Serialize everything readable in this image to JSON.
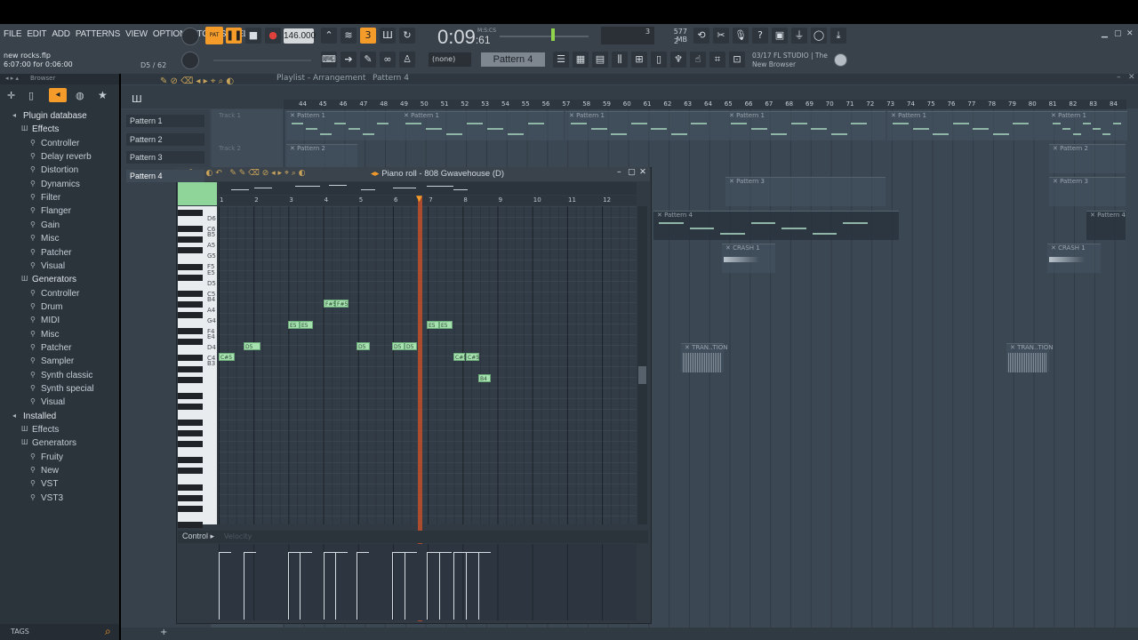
{
  "menu": [
    "FILE",
    "EDIT",
    "ADD",
    "PATTERNS",
    "VIEW",
    "OPTIONS",
    "TOOLS",
    "HELP"
  ],
  "transport": {
    "pat_label": "PAT",
    "tempo": "146.000",
    "time_main": "0:09",
    "time_sub": "61",
    "time_unit": "M:S:CS",
    "cpu_value": "3",
    "memory": "577 MB",
    "poly": "2"
  },
  "project": {
    "file": "new rocks.flp",
    "time": "6:07:00 for 0:06:00",
    "hint_note": "D5 / 62"
  },
  "pattern_selector": {
    "none_label": "(none)",
    "current": "Pattern 4"
  },
  "news": {
    "line1": "03/17  FL STUDIO | The",
    "line2": "New Browser"
  },
  "browser": {
    "title": "Browser",
    "tree": [
      {
        "label": "Plugin database",
        "level": 0,
        "bold": true
      },
      {
        "label": "Effects",
        "level": 1,
        "bold": true
      },
      {
        "label": "Controller",
        "level": 2
      },
      {
        "label": "Delay reverb",
        "level": 2
      },
      {
        "label": "Distortion",
        "level": 2
      },
      {
        "label": "Dynamics",
        "level": 2
      },
      {
        "label": "Filter",
        "level": 2
      },
      {
        "label": "Flanger",
        "level": 2
      },
      {
        "label": "Gain",
        "level": 2
      },
      {
        "label": "Misc",
        "level": 2
      },
      {
        "label": "Patcher",
        "level": 2
      },
      {
        "label": "Visual",
        "level": 2
      },
      {
        "label": "Generators",
        "level": 1,
        "bold": true
      },
      {
        "label": "Controller",
        "level": 2
      },
      {
        "label": "Drum",
        "level": 2
      },
      {
        "label": "MIDI",
        "level": 2
      },
      {
        "label": "Misc",
        "level": 2
      },
      {
        "label": "Patcher",
        "level": 2
      },
      {
        "label": "Sampler",
        "level": 2
      },
      {
        "label": "Synth classic",
        "level": 2
      },
      {
        "label": "Synth special",
        "level": 2
      },
      {
        "label": "Visual",
        "level": 2
      },
      {
        "label": "Installed",
        "level": 0,
        "bold": true
      },
      {
        "label": "Effects",
        "level": 1
      },
      {
        "label": "Generators",
        "level": 1
      },
      {
        "label": "Fruity",
        "level": 2
      },
      {
        "label": "New",
        "level": 2
      },
      {
        "label": "VST",
        "level": 2
      },
      {
        "label": "VST3",
        "level": 2
      }
    ],
    "tags_label": "TAGS"
  },
  "playlist": {
    "title_parts": [
      "Playlist - Arrangement",
      "Pattern 4"
    ],
    "patterns": [
      "Pattern 1",
      "Pattern 2",
      "Pattern 3",
      "Pattern 4"
    ],
    "tracks": [
      "Track 1",
      "Track 2"
    ],
    "ruler": [
      "44",
      "45",
      "46",
      "47",
      "48",
      "49",
      "50",
      "51",
      "52",
      "53",
      "54",
      "55",
      "56",
      "57",
      "58",
      "59",
      "60",
      "61",
      "62",
      "63",
      "64",
      "65",
      "66",
      "67",
      "68",
      "69",
      "70",
      "71",
      "72",
      "73",
      "74",
      "75",
      "76",
      "77",
      "78",
      "79",
      "80",
      "81",
      "82",
      "83",
      "84"
    ],
    "clips": [
      {
        "label": "Pattern 1"
      },
      {
        "label": "Pattern 1"
      },
      {
        "label": "Pattern 1"
      },
      {
        "label": "Pattern 1"
      },
      {
        "label": "Pattern 1"
      },
      {
        "label": "Pattern 1"
      },
      {
        "label": "Pattern 1"
      },
      {
        "label": "Pattern 1"
      },
      {
        "label": "Pattern 2"
      },
      {
        "label": "Pattern 2"
      },
      {
        "label": "Pattern 3"
      },
      {
        "label": "Pattern 3"
      },
      {
        "label": "Pattern 4"
      },
      {
        "label": "Pattern 4"
      },
      {
        "label": "CRASH 1"
      },
      {
        "label": "CRASH 1"
      },
      {
        "label": "TRAN..TION"
      },
      {
        "label": "TRAN..TION"
      }
    ]
  },
  "piano_roll": {
    "title": "Piano roll - 808 Gwavehouse (D)",
    "ruler": [
      "1",
      "2",
      "3",
      "4",
      "5",
      "6",
      "7",
      "8",
      "9",
      "10",
      "11",
      "12"
    ],
    "key_labels": [
      "D6",
      "C6",
      "B5",
      "A5",
      "G5",
      "F5",
      "E5",
      "D5",
      "C5",
      "B4",
      "A4",
      "G4",
      "F4",
      "E4",
      "D4",
      "C4",
      "B3"
    ],
    "notes": [
      {
        "label": "C#5"
      },
      {
        "label": "D5"
      },
      {
        "label": "E5"
      },
      {
        "label": "E5"
      },
      {
        "label": "F#5"
      },
      {
        "label": "F#5"
      },
      {
        "label": "D5"
      },
      {
        "label": "D5"
      },
      {
        "label": "D5"
      },
      {
        "label": "E5"
      },
      {
        "label": "E5"
      },
      {
        "label": "C#5"
      },
      {
        "label": "C#5"
      },
      {
        "label": "B4"
      }
    ],
    "control_label": "Control",
    "velocity_label": "Velocity"
  }
}
